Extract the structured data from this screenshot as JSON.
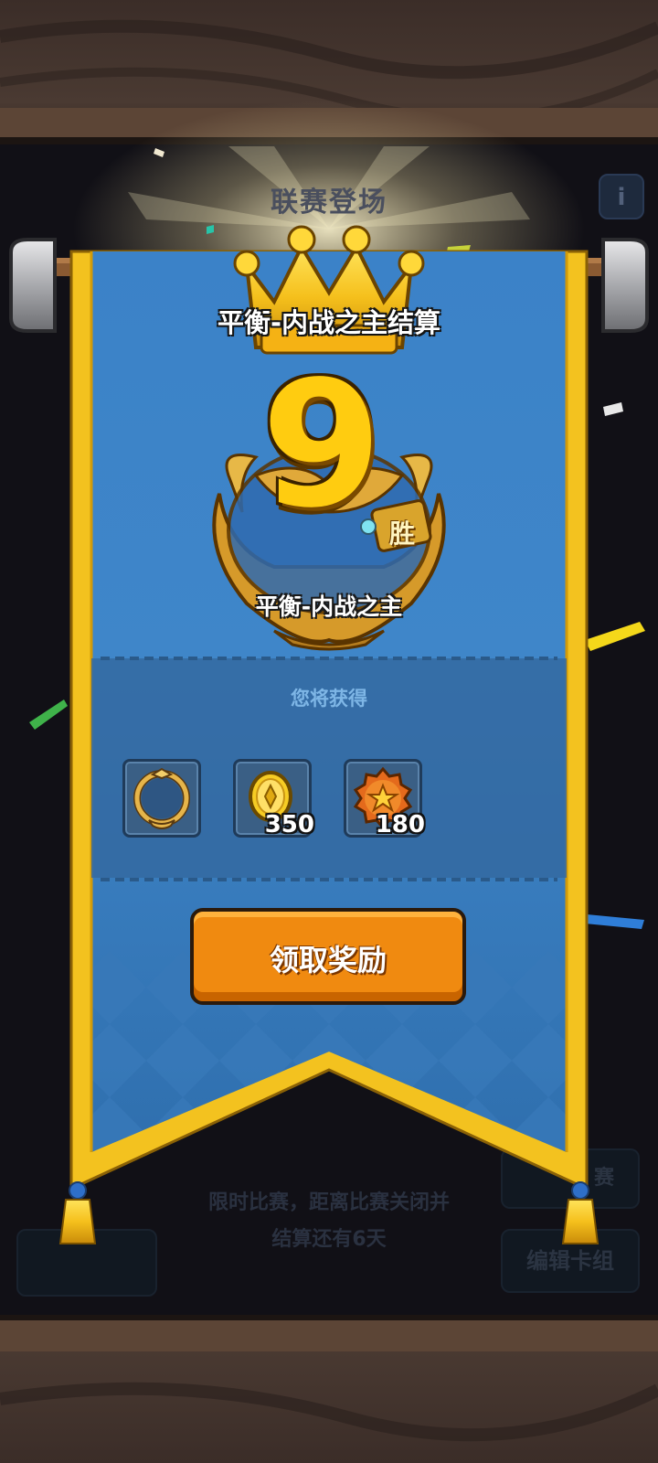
{
  "background": {
    "title": "联赛登场",
    "info_icon": "i",
    "notice_line1": "限时比赛，距离比赛关闭并",
    "notice_line2": "结算还有6天",
    "edit_deck_label": "编辑卡组",
    "right_top_label": "赛"
  },
  "panel": {
    "title": "平衡-内战之主结算",
    "win_count": "9",
    "win_suffix": "胜",
    "medal_name": "平衡-内战之主",
    "rewards_label": "您将获得",
    "rewards": [
      {
        "icon": "avatar-frame-icon",
        "quantity": ""
      },
      {
        "icon": "gold-coin-icon",
        "quantity": "350"
      },
      {
        "icon": "star-badge-icon",
        "quantity": "180"
      }
    ],
    "claim_button_label": "领取奖励"
  },
  "colors": {
    "banner_blue": "#3f84c9",
    "banner_border": "#f3c21f",
    "claim_orange": "#f08a10",
    "win_gold": "#ffcc10"
  }
}
